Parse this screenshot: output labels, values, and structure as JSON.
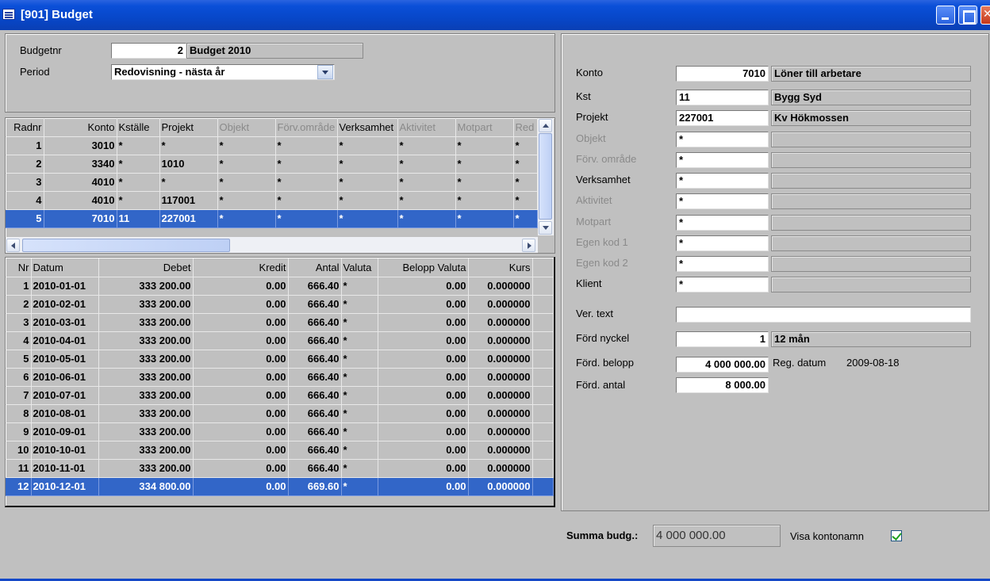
{
  "window": {
    "title": "[901]  Budget"
  },
  "header": {
    "budgetnr_label": "Budgetnr",
    "budgetnr_value": "2",
    "budget_name": "Budget 2010",
    "period_label": "Period",
    "period_value": "Redovisning - nästa år"
  },
  "rows_grid": {
    "columns": [
      "Radnr",
      "Konto",
      "Kställe",
      "Projekt",
      "Objekt",
      "Förv.område",
      "Verksamhet",
      "Aktivitet",
      "Motpart",
      "Red"
    ],
    "rows": [
      [
        "1",
        "3010",
        "*",
        "*",
        "*",
        "*",
        "*",
        "*",
        "*",
        "*"
      ],
      [
        "2",
        "3340",
        "*",
        "1010",
        "*",
        "*",
        "*",
        "*",
        "*",
        "*"
      ],
      [
        "3",
        "4010",
        "*",
        "*",
        "*",
        "*",
        "*",
        "*",
        "*",
        "*"
      ],
      [
        "4",
        "4010",
        "*",
        "117001",
        "*",
        "*",
        "*",
        "*",
        "*",
        "*"
      ],
      [
        "5",
        "7010",
        "11",
        "227001",
        "*",
        "*",
        "*",
        "*",
        "*",
        "*"
      ]
    ]
  },
  "periods_grid": {
    "columns": [
      "Nr",
      "Datum",
      "Debet",
      "Kredit",
      "Antal",
      "Valuta",
      "Belopp Valuta",
      "Kurs"
    ],
    "rows": [
      [
        "1",
        "2010-01-01",
        "333 200.00",
        "0.00",
        "666.40",
        "*",
        "0.00",
        "0.000000"
      ],
      [
        "2",
        "2010-02-01",
        "333 200.00",
        "0.00",
        "666.40",
        "*",
        "0.00",
        "0.000000"
      ],
      [
        "3",
        "2010-03-01",
        "333 200.00",
        "0.00",
        "666.40",
        "*",
        "0.00",
        "0.000000"
      ],
      [
        "4",
        "2010-04-01",
        "333 200.00",
        "0.00",
        "666.40",
        "*",
        "0.00",
        "0.000000"
      ],
      [
        "5",
        "2010-05-01",
        "333 200.00",
        "0.00",
        "666.40",
        "*",
        "0.00",
        "0.000000"
      ],
      [
        "6",
        "2010-06-01",
        "333 200.00",
        "0.00",
        "666.40",
        "*",
        "0.00",
        "0.000000"
      ],
      [
        "7",
        "2010-07-01",
        "333 200.00",
        "0.00",
        "666.40",
        "*",
        "0.00",
        "0.000000"
      ],
      [
        "8",
        "2010-08-01",
        "333 200.00",
        "0.00",
        "666.40",
        "*",
        "0.00",
        "0.000000"
      ],
      [
        "9",
        "2010-09-01",
        "333 200.00",
        "0.00",
        "666.40",
        "*",
        "0.00",
        "0.000000"
      ],
      [
        "10",
        "2010-10-01",
        "333 200.00",
        "0.00",
        "666.40",
        "*",
        "0.00",
        "0.000000"
      ],
      [
        "11",
        "2010-11-01",
        "333 200.00",
        "0.00",
        "666.40",
        "*",
        "0.00",
        "0.000000"
      ],
      [
        "12",
        "2010-12-01",
        "334 800.00",
        "0.00",
        "669.60",
        "*",
        "0.00",
        "0.000000"
      ]
    ]
  },
  "detail": {
    "konto_label": "Konto",
    "konto_value": "7010",
    "konto_name": "Löner till arbetare",
    "kst_label": "Kst",
    "kst_value": "11",
    "kst_name": "Bygg Syd",
    "projekt_label": "Projekt",
    "projekt_value": "227001",
    "projekt_name": "Kv Hökmossen",
    "objekt_label": "Objekt",
    "objekt_value": "*",
    "forv_label": "Förv. område",
    "forv_value": "*",
    "verksamhet_label": "Verksamhet",
    "verksamhet_value": "*",
    "aktivitet_label": "Aktivitet",
    "aktivitet_value": "*",
    "motpart_label": "Motpart",
    "motpart_value": "*",
    "egen1_label": "Egen kod 1",
    "egen1_value": "*",
    "egen2_label": "Egen kod 2",
    "egen2_value": "*",
    "klient_label": "Klient",
    "klient_value": "*",
    "vertext_label": "Ver. text",
    "vertext_value": "",
    "fordnyckel_label": "Förd nyckel",
    "fordnyckel_value": "1",
    "fordnyckel_name": "12 mån",
    "fordbelopp_label": "Förd. belopp",
    "fordbelopp_value": "4 000 000.00",
    "regdatum_label": "Reg. datum",
    "regdatum_value": "2009-08-18",
    "fordantal_label": "Förd. antal",
    "fordantal_value": "8 000.00"
  },
  "footer": {
    "summa_label": "Summa budg.:",
    "summa_value": "4 000 000.00",
    "visa_label": "Visa kontonamn",
    "visa_checked": true
  }
}
